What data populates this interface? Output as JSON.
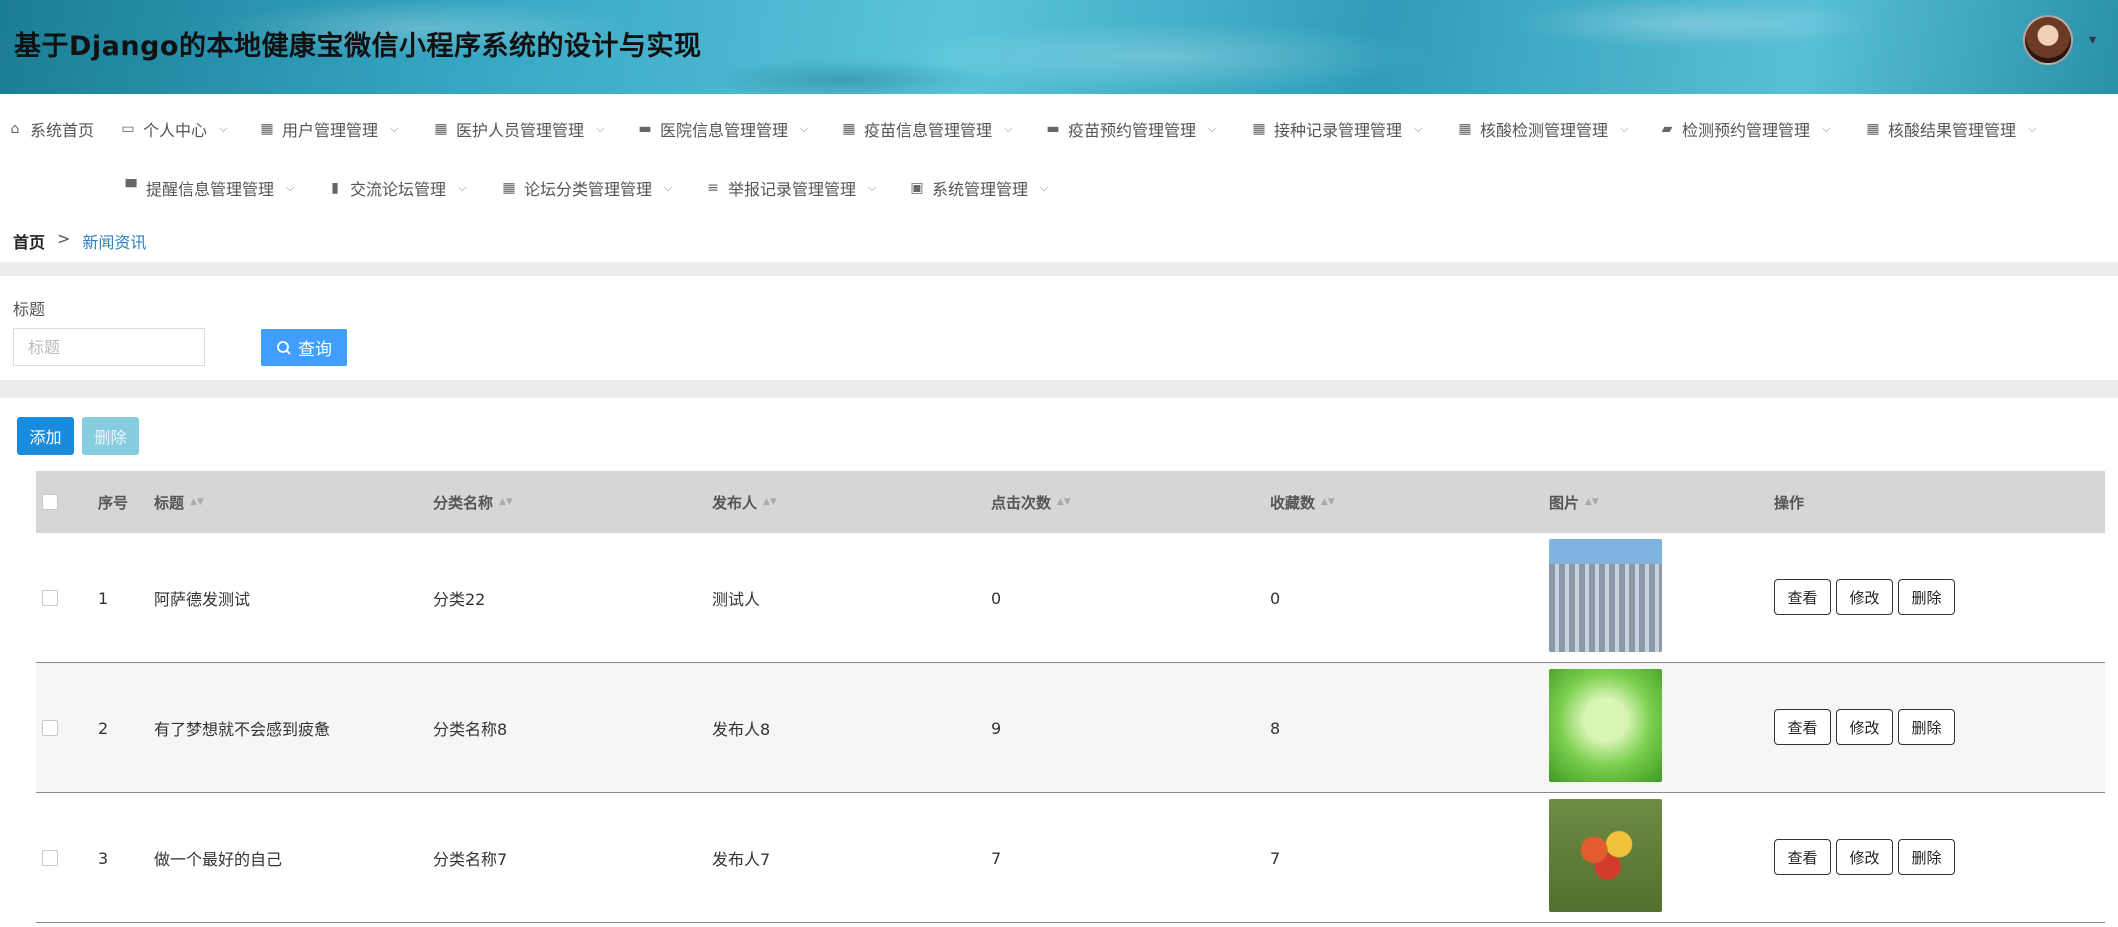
{
  "header": {
    "title": "基于Django的本地健康宝微信小程序系统的设计与实现"
  },
  "nav": {
    "items": [
      {
        "label": "系统首页"
      },
      {
        "label": "个人中心"
      },
      {
        "label": "用户管理管理"
      },
      {
        "label": "医护人员管理管理"
      },
      {
        "label": "医院信息管理管理"
      },
      {
        "label": "疫苗信息管理管理"
      },
      {
        "label": "疫苗预约管理管理"
      },
      {
        "label": "接种记录管理管理"
      },
      {
        "label": "核酸检测管理管理"
      },
      {
        "label": "检测预约管理管理"
      },
      {
        "label": "核酸结果管理管理"
      },
      {
        "label": "提醒信息管理管理"
      },
      {
        "label": "交流论坛管理"
      },
      {
        "label": "论坛分类管理管理"
      },
      {
        "label": "举报记录管理管理"
      },
      {
        "label": "系统管理管理"
      }
    ]
  },
  "breadcrumb": {
    "home": "首页",
    "separator": ">",
    "current": "新闻资讯"
  },
  "search": {
    "label": "标题",
    "placeholder": "标题",
    "button_label": "查询"
  },
  "toolbar": {
    "add_label": "添加",
    "delete_label": "删除"
  },
  "table": {
    "headers": {
      "index": "序号",
      "title": "标题",
      "category": "分类名称",
      "publisher": "发布人",
      "clicks": "点击次数",
      "favorites": "收藏数",
      "image": "图片",
      "actions": "操作"
    },
    "rows": [
      {
        "index": "1",
        "title": "阿萨德发测试",
        "category": "分类22",
        "publisher": "测试人",
        "clicks": "0",
        "favorites": "0"
      },
      {
        "index": "2",
        "title": "有了梦想就不会感到疲惫",
        "category": "分类名称8",
        "publisher": "发布人8",
        "clicks": "9",
        "favorites": "8"
      },
      {
        "index": "3",
        "title": "做一个最好的自己",
        "category": "分类名称7",
        "publisher": "发布人7",
        "clicks": "7",
        "favorites": "7"
      }
    ],
    "row_actions": {
      "view": "查看",
      "edit": "修改",
      "delete": "删除"
    }
  },
  "colors": {
    "primary": "#409eff",
    "add_button": "#1a8bdc",
    "delete_disabled": "#86cddf",
    "breadcrumb_active": "#2d7fc6"
  }
}
